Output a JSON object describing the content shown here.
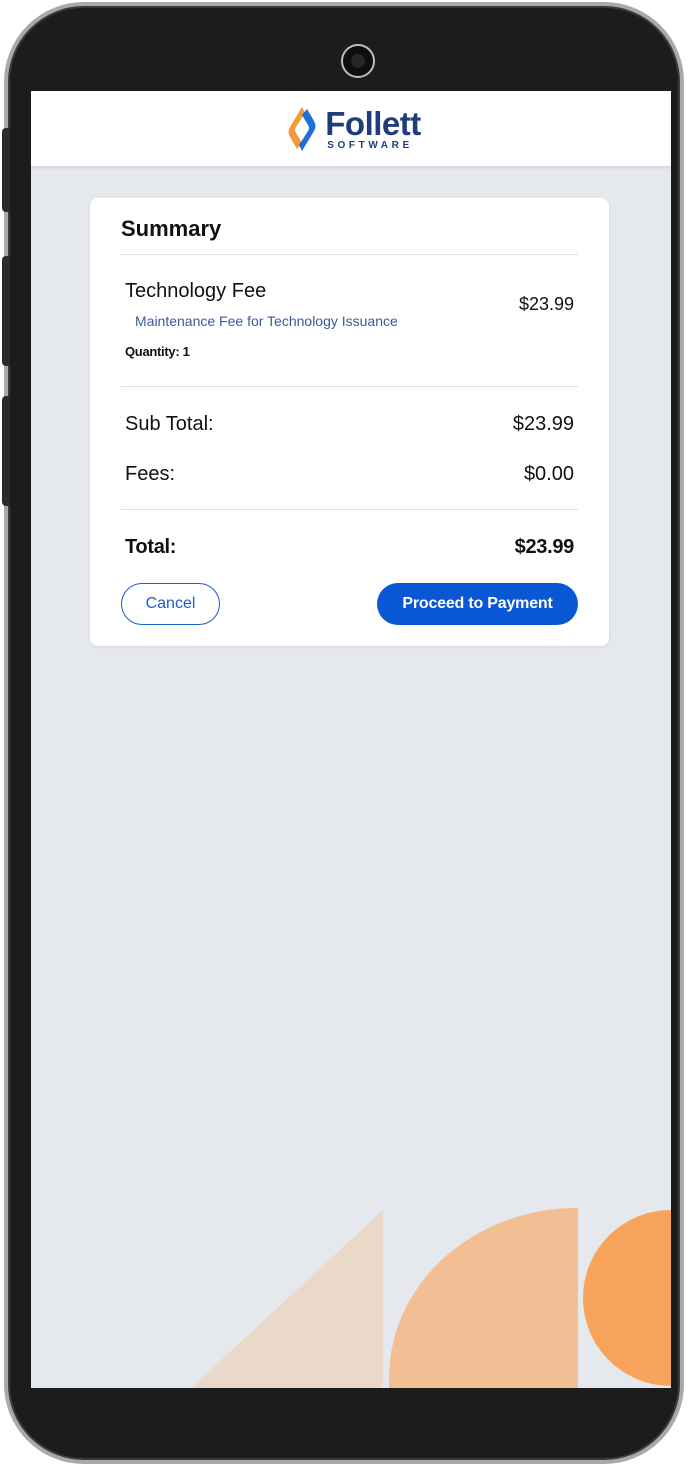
{
  "brand": {
    "name": "Follett",
    "tagline": "SOFTWARE",
    "icon": "follett-logo-icon",
    "colors": {
      "primary": "#1f3d7a",
      "accent_orange": "#f39a3a",
      "accent_blue": "#1f6fd6"
    }
  },
  "summary": {
    "title": "Summary",
    "item": {
      "name": "Technology Fee",
      "description": "Maintenance Fee for Technology Issuance",
      "quantity_label": "Quantity: 1",
      "price": "$23.99"
    },
    "subtotal": {
      "label": "Sub Total:",
      "value": "$23.99"
    },
    "fees": {
      "label": "Fees:",
      "value": "$0.00"
    },
    "total": {
      "label": "Total:",
      "value": "$23.99"
    }
  },
  "actions": {
    "cancel_label": "Cancel",
    "proceed_label": "Proceed to Payment",
    "button_color": "#0a57d6"
  },
  "background": {
    "color": "#e5e8ec",
    "decor_colors": [
      "#ead9c8",
      "#f2bf94",
      "#f8a35b"
    ]
  }
}
